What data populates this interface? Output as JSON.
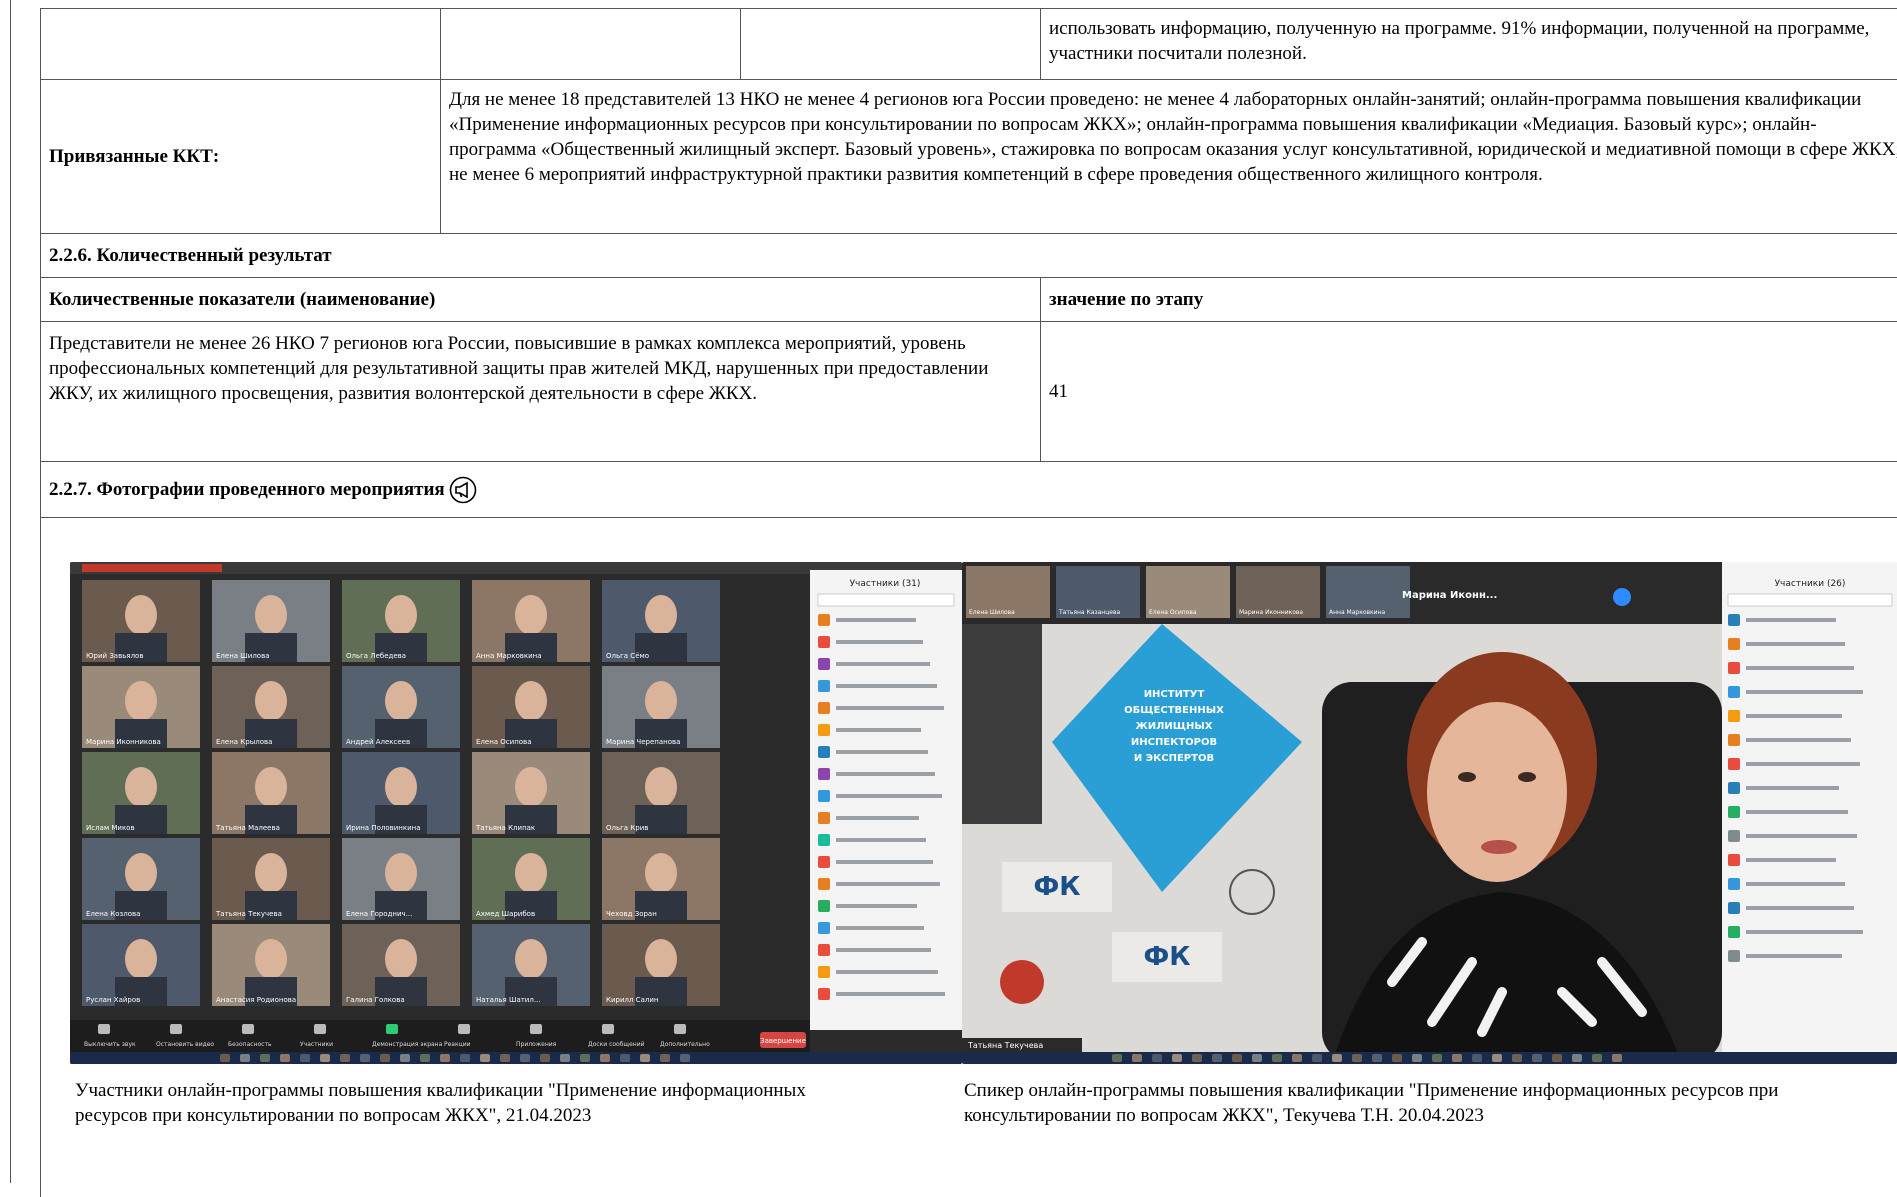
{
  "top_row": {
    "text": "использовать информацию, полученную на программе. 91% информации, полученной на программе, участники посчитали полезной."
  },
  "linked": {
    "label": "Привязанные ККТ:",
    "text": "Для не менее 18 представителей 13 НКО не менее 4 регионов юга России проведено: не менее 4 лабораторных онлайн-занятий; онлайн-программа повышения квалификации «Применение информационных ресурсов при консультировании по вопросам ЖКХ»; онлайн-программа повышения квалификации «Медиация. Базовый курс»; онлайн-программа «Общественный жилищный эксперт. Базовый уровень», стажировка по вопросам оказания услуг консультативной, юридической и медиативной помощи в сфере ЖКХ; не менее 6 мероприятий инфраструктурной практики развития компетенций в сфере проведения общественного жилищного контроля."
  },
  "section_quant": {
    "title": "2.2.6. Количественный результат",
    "col_name": "Количественные показатели (наименование)",
    "col_value": "значение по этапу",
    "row_text": "Представители не менее 26 НКО 7 регионов юга России, повысившие в рамках комплекса мероприятий, уровень профессиональных компетенций для результативной защиты прав жителей МКД, нарушенных при предоставлении ЖКУ, их жилищного просвещения, развития волонтерской деятельности в сфере ЖКХ.",
    "row_value": "41"
  },
  "section_photos": {
    "title": "2.2.7. Фотографии проведенного мероприятия",
    "icon": "loudspeaker-icon",
    "photo1_caption": "Участники онлайн-программы повышения квалификации \"Применение информационных ресурсов при консультировании по вопросам ЖКХ\", 21.04.2023",
    "photo2_caption": "Спикер онлайн-программы повышения квалификации \"Применение информационных ресурсов при консультировании по вопросам ЖКХ\", Текучева Т.Н. 20.04.2023"
  },
  "photo1": {
    "participants_header": "Участники (31)",
    "tiles": [
      "Юрий Завьялов",
      "Елена Шилова",
      "Ольга Лебедева",
      "Анна Марковкина",
      "Ольга Сёмо",
      "Марина Иконникова",
      "Елена Крылова",
      "Андрей Алексеев",
      "Елена Осипова",
      "Марина Черепанова",
      "Ислам Миков",
      "Татьяна Малеева",
      "Ирина Половинкина",
      "Татьяна Клипак",
      "Ольга Крив",
      "Елена Козлова",
      "Татьяна Текучева",
      "Елена Городнич...",
      "Ахмед Шарибов",
      "Чеховд Зоран",
      "Руслан Хайров",
      "Анастасия Родионова",
      "Галина Голкова",
      "Наталья Шатил...",
      "Кирилл Салин"
    ],
    "toolbar": [
      "Выключить звук",
      "Остановить видео",
      "Безопасность",
      "Участники",
      "Демонстрация экрана",
      "Реакции",
      "Приложения",
      "Доски сообщений",
      "Дополнительно"
    ],
    "end_button": "Завершение"
  },
  "photo2": {
    "participants_header": "Участники (26)",
    "banner_lines": [
      "ИНСТИТУТ",
      "ОБЩЕСТВЕННЫХ",
      "ЖИЛИЩНЫХ",
      "ИНСПЕКТОРОВ",
      "И ЭКСПЕРТОВ"
    ],
    "top_names": [
      "Елена Шилова",
      "Татьяна Казанцева",
      "Елена Осипова",
      "Марина Иконникова",
      "Анна Марковкина"
    ],
    "top_label": "Марина Иконн...",
    "speaker_label": "Татьяна Текучева"
  }
}
